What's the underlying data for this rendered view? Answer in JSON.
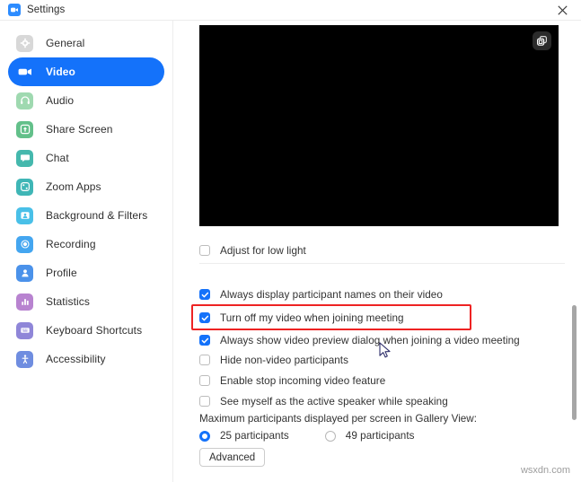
{
  "window": {
    "title": "Settings",
    "app_icon": "zoom-camera-icon",
    "close_icon": "close-icon"
  },
  "colors": {
    "accent": "#1472fa",
    "highlight": "#ee2323",
    "title_text": "#2b2b2b"
  },
  "sidebar": {
    "items": [
      {
        "label": "General",
        "icon": "gear-icon",
        "color": "#d8d8d8",
        "active": false
      },
      {
        "label": "Video",
        "icon": "camera-icon",
        "color": "#1472fa",
        "active": true
      },
      {
        "label": "Audio",
        "icon": "headset-icon",
        "color": "#77c88f",
        "active": false
      },
      {
        "label": "Share Screen",
        "icon": "upload-icon",
        "color": "#63c08a",
        "active": false
      },
      {
        "label": "Chat",
        "icon": "chat-icon",
        "color": "#45b8ad",
        "active": false
      },
      {
        "label": "Zoom Apps",
        "icon": "apps-icon",
        "color": "#3fb6b6",
        "active": false
      },
      {
        "label": "Background & Filters",
        "icon": "person-frame-icon",
        "color": "#49c0e8",
        "active": false
      },
      {
        "label": "Recording",
        "icon": "record-icon",
        "color": "#44a6f0",
        "active": false
      },
      {
        "label": "Profile",
        "icon": "person-icon",
        "color": "#4b92ea",
        "active": false
      },
      {
        "label": "Statistics",
        "icon": "bar-chart-icon",
        "color": "#b883d0",
        "active": false
      },
      {
        "label": "Keyboard Shortcuts",
        "icon": "keyboard-icon",
        "color": "#8f86d8",
        "active": false
      },
      {
        "label": "Accessibility",
        "icon": "accessibility-icon",
        "color": "#6f8de0",
        "active": false
      }
    ]
  },
  "video": {
    "preview_label": "video-preview",
    "pip_icon": "picture-in-picture-icon"
  },
  "options": {
    "adjust_low_light": {
      "label": "Adjust for low light",
      "checked": false
    },
    "list": [
      {
        "label": "Always display participant names on their video",
        "checked": true
      },
      {
        "label": "Turn off my video when joining meeting",
        "checked": true,
        "highlighted": true
      },
      {
        "label": "Always show video preview dialog when joining a video meeting",
        "checked": true
      },
      {
        "label": "Hide non-video participants",
        "checked": false
      },
      {
        "label": "Enable stop incoming video feature",
        "checked": false
      },
      {
        "label": "See myself as the active speaker while speaking",
        "checked": false
      }
    ]
  },
  "gallery": {
    "section_label": "Maximum participants displayed per screen in Gallery View:",
    "radios": [
      {
        "label": "25 participants",
        "selected": true
      },
      {
        "label": "49 participants",
        "selected": false
      }
    ]
  },
  "buttons": {
    "advanced": "Advanced"
  },
  "watermark": "wsxdn.com"
}
